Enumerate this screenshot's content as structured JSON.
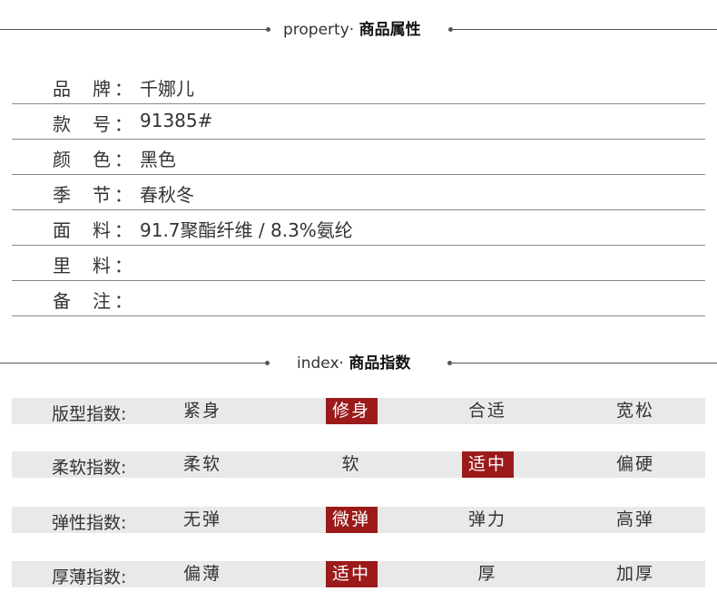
{
  "property_header": {
    "en": "property·",
    "cn": "商品属性"
  },
  "properties": [
    {
      "k1": "品",
      "k2": "牌",
      "colon": "：",
      "value": "千娜儿"
    },
    {
      "k1": "款",
      "k2": "号",
      "colon": "：",
      "value": "91385#"
    },
    {
      "k1": "颜",
      "k2": "色",
      "colon": "：",
      "value": "黑色"
    },
    {
      "k1": "季",
      "k2": "节",
      "colon": "：",
      "value": "春秋冬"
    },
    {
      "k1": "面",
      "k2": "料",
      "colon": "：",
      "value": "91.7聚酯纤维 / 8.3%氨纶"
    },
    {
      "k1": "里",
      "k2": "料",
      "colon": "：",
      "value": ""
    },
    {
      "k1": "备",
      "k2": "注",
      "colon": "：",
      "value": ""
    }
  ],
  "index_header": {
    "en": "index·",
    "cn": "商品指数"
  },
  "indices": [
    {
      "label": "版型指数:",
      "options": [
        "紧身",
        "修身",
        "合适",
        "宽松"
      ],
      "selected": 1
    },
    {
      "label": "柔软指数:",
      "options": [
        "柔软",
        "软",
        "适中",
        "偏硬"
      ],
      "selected": 2
    },
    {
      "label": "弹性指数:",
      "options": [
        "无弹",
        "微弹",
        "弹力",
        "高弹"
      ],
      "selected": 1
    },
    {
      "label": "厚薄指数:",
      "options": [
        "偏薄",
        "适中",
        "厚",
        "加厚"
      ],
      "selected": 1
    }
  ],
  "colors": {
    "selected_bg": "#9b1a1a",
    "row_bg": "#e9e9e9",
    "rule": "#8a8a8a"
  }
}
